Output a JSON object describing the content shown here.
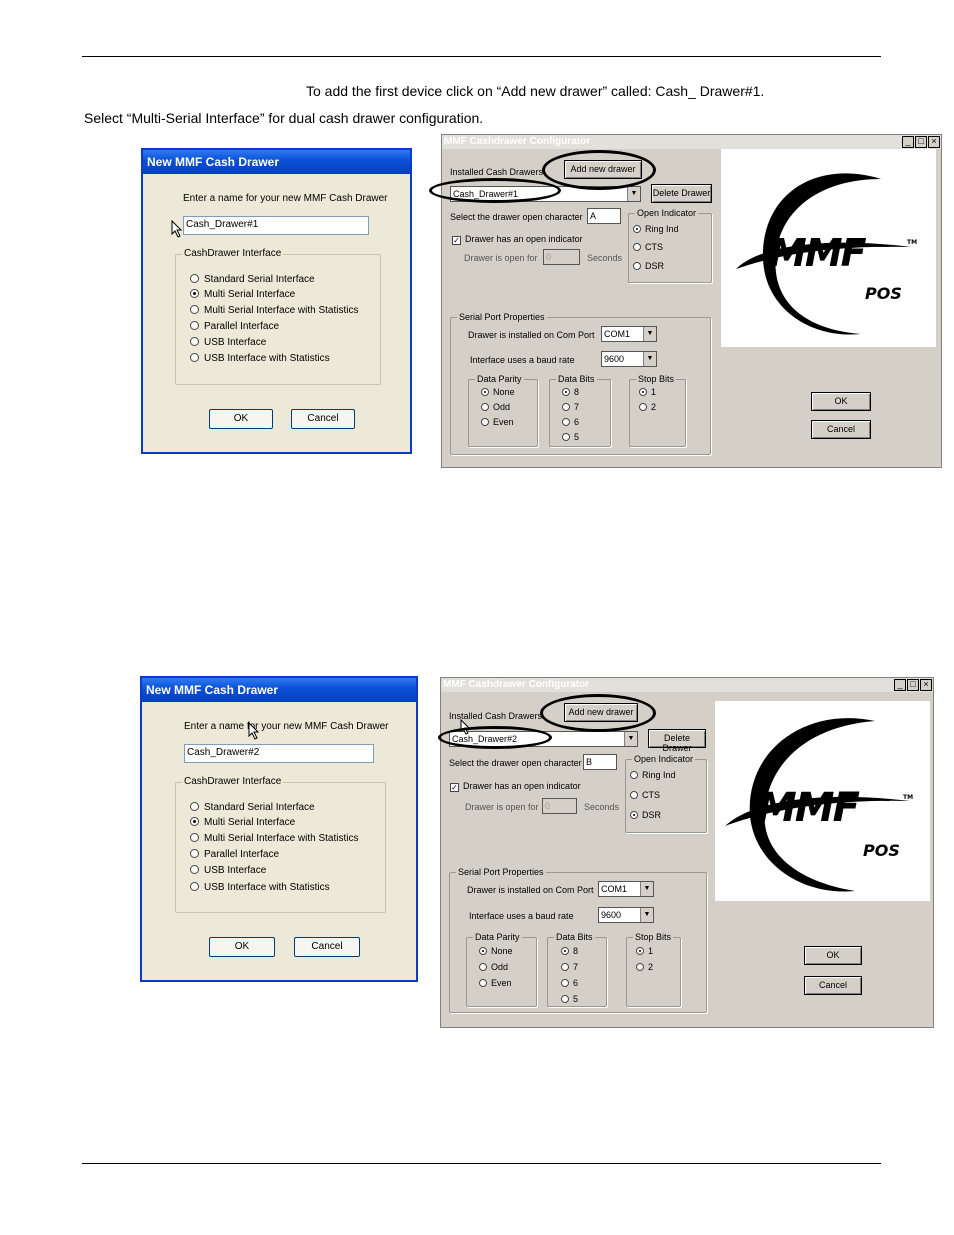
{
  "doc": {
    "line1": "To add the first device click on “Add new drawer” called: Cash_ Drawer#1.",
    "line2": "Select “Multi-Serial Interface” for dual cash drawer configuration."
  },
  "dialog1": {
    "title": "New MMF Cash Drawer",
    "prompt": "Enter a name for your new MMF Cash Drawer",
    "name_value": "Cash_Drawer#1",
    "group_title": "CashDrawer Interface",
    "options": [
      "Standard Serial Interface",
      "Multi Serial Interface",
      "Multi Serial Interface with Statistics",
      "Parallel Interface",
      "USB Interface",
      "USB Interface with Statistics"
    ],
    "selected_option": "Multi Serial Interface",
    "ok": "OK",
    "cancel": "Cancel"
  },
  "config1": {
    "title": "MMF Cashdrawer Configurator",
    "installed_label": "Installed Cash Drawers",
    "add_button": "Add new drawer",
    "delete_button": "Delete Drawer",
    "drawer_value": "Cash_Drawer#1",
    "open_char_label": "Select the drawer open character",
    "open_char_value": "A",
    "open_indicator_title": "Open Indicator",
    "indicator_options": [
      "Ring Ind",
      "CTS",
      "DSR"
    ],
    "indicator_selected": "Ring Ind",
    "has_indicator_label": "Drawer has an open indicator",
    "open_for_label": "Drawer is open for",
    "open_for_value": "0",
    "seconds_label": "Seconds",
    "serial_title": "Serial Port Properties",
    "com_label": "Drawer is installed on Com Port",
    "com_value": "COM1",
    "baud_label": "Interface uses a baud rate",
    "baud_value": "9600",
    "parity_title": "Data Parity",
    "parity_options": [
      "None",
      "Odd",
      "Even"
    ],
    "databits_title": "Data Bits",
    "databits_options": [
      "8",
      "7",
      "6",
      "5"
    ],
    "stopbits_title": "Stop Bits",
    "stopbits_options": [
      "1",
      "2"
    ],
    "ok": "OK",
    "cancel": "Cancel",
    "logo_main": "MMF",
    "logo_tm": "TM",
    "logo_sub": "POS"
  },
  "dialog2": {
    "title": "New MMF Cash Drawer",
    "prompt": "Enter a name for your new MMF Cash Drawer",
    "name_value": "Cash_Drawer#2",
    "group_title": "CashDrawer Interface",
    "options": [
      "Standard Serial Interface",
      "Multi Serial Interface",
      "Multi Serial Interface with Statistics",
      "Parallel Interface",
      "USB Interface",
      "USB Interface with Statistics"
    ],
    "selected_option": "Multi Serial Interface",
    "ok": "OK",
    "cancel": "Cancel"
  },
  "config2": {
    "title": "MMF Cashdrawer Configurator",
    "installed_label": "Installed Cash Drawers",
    "add_button": "Add new drawer",
    "delete_button": "Delete Drawer",
    "drawer_value": "Cash_Drawer#2",
    "open_char_label": "Select the drawer open character",
    "open_char_value": "B",
    "open_indicator_title": "Open Indicator",
    "indicator_options": [
      "Ring Ind",
      "CTS",
      "DSR"
    ],
    "indicator_selected": "DSR",
    "has_indicator_label": "Drawer has an open indicator",
    "open_for_label": "Drawer is open for",
    "open_for_value": "0",
    "seconds_label": "Seconds",
    "serial_title": "Serial Port Properties",
    "com_label": "Drawer is installed on Com Port",
    "com_value": "COM1",
    "baud_label": "Interface uses a baud rate",
    "baud_value": "9600",
    "parity_title": "Data Parity",
    "parity_options": [
      "None",
      "Odd",
      "Even"
    ],
    "databits_title": "Data Bits",
    "databits_options": [
      "8",
      "7",
      "6",
      "5"
    ],
    "stopbits_title": "Stop Bits",
    "stopbits_options": [
      "1",
      "2"
    ],
    "ok": "OK",
    "cancel": "Cancel",
    "logo_main": "MMF",
    "logo_tm": "TM",
    "logo_sub": "POS"
  }
}
